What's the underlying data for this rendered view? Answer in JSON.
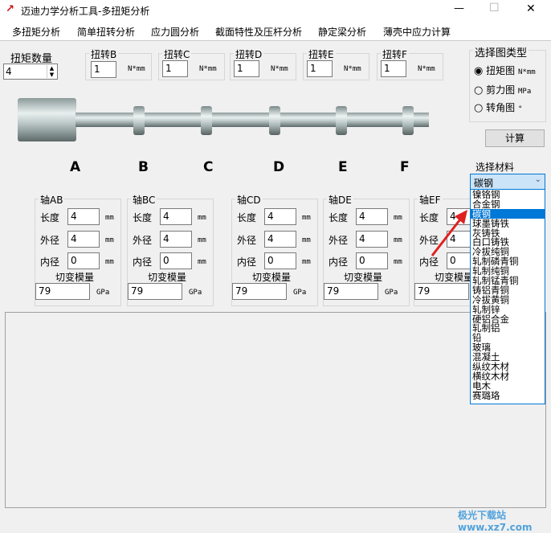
{
  "window": {
    "title": "迈迪力学分析工具-多扭矩分析",
    "minimize": "—",
    "maximize": "☐",
    "close": "✕"
  },
  "menu": [
    "多扭矩分析",
    "简单扭转分析",
    "应力圆分析",
    "截面特性及压杆分析",
    "静定梁分析",
    "薄壳中应力计算"
  ],
  "torque_count": {
    "label": "扭矩数量",
    "value": "4"
  },
  "torques": [
    {
      "label": "扭转B",
      "value": "1",
      "unit": "N*mm"
    },
    {
      "label": "扭转C",
      "value": "1",
      "unit": "N*mm"
    },
    {
      "label": "扭转D",
      "value": "1",
      "unit": "N*mm"
    },
    {
      "label": "扭转E",
      "value": "1",
      "unit": "N*mm"
    },
    {
      "label": "扭转F",
      "value": "1",
      "unit": "N*mm"
    }
  ],
  "chart_type": {
    "label": "选择图类型",
    "options": [
      {
        "label": "扭矩图",
        "unit": "N*mm",
        "checked": true
      },
      {
        "label": "剪力图",
        "unit": "MPa",
        "checked": false
      },
      {
        "label": "转角图",
        "unit": "°",
        "checked": false
      }
    ]
  },
  "calc_button": "计算",
  "points": [
    "A",
    "B",
    "C",
    "D",
    "E",
    "F"
  ],
  "axes": [
    {
      "title": "轴AB",
      "length": "4",
      "outer": "4",
      "inner": "0",
      "shear": "79"
    },
    {
      "title": "轴BC",
      "length": "4",
      "outer": "4",
      "inner": "0",
      "shear": "79"
    },
    {
      "title": "轴CD",
      "length": "4",
      "outer": "4",
      "inner": "0",
      "shear": "79"
    },
    {
      "title": "轴DE",
      "length": "4",
      "outer": "4",
      "inner": "0",
      "shear": "79"
    },
    {
      "title": "轴EF",
      "length": "4",
      "outer": "4",
      "inner": "0",
      "shear": "79"
    }
  ],
  "axis_labels": {
    "length": "长度",
    "outer": "外径",
    "inner": "内径",
    "shear": "切变模量",
    "mm": "mm",
    "gpa": "GPa"
  },
  "material": {
    "label": "选择材料",
    "selected": "碳钢",
    "options": [
      "镍铬钢",
      "合金钢",
      "碳钢",
      "球墨铸铁",
      "灰铸铁",
      "白口铸铁",
      "冷拔纯铜",
      "轧制磷青铜",
      "轧制纯铜",
      "轧制锰青铜",
      "铸铝青铜",
      "冷拔黄铜",
      "轧制锌",
      "硬铝合金",
      "轧制铝",
      "铅",
      "玻璃",
      "混凝土",
      "纵纹木材",
      "横纹木材",
      "电木",
      "赛璐珞"
    ]
  },
  "watermark": "极光下载站 www.xz7.com"
}
